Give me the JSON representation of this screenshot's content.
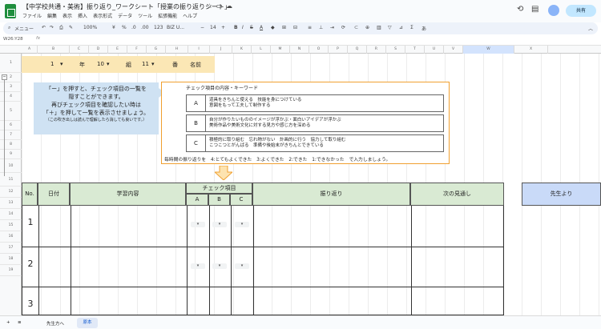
{
  "title": "【中学校共通・美術】振り返り_ワークシート「授業の振り返りシート」",
  "menu": [
    "ファイル",
    "編集",
    "表示",
    "挿入",
    "表示形式",
    "データ",
    "ツール",
    "拡張機能",
    "ヘルプ"
  ],
  "share_label": "共有",
  "toolbar": {
    "search": "メニュー",
    "zoom": "100%",
    "currency": "¥",
    "percent": "%",
    "dec1": ".0",
    "dec2": ".00",
    "num": "123",
    "font": "BIZ U...",
    "size": "14"
  },
  "namebox": "W26:Y28",
  "fx": "fx",
  "columns": [
    "A",
    "B",
    "C",
    "D",
    "E",
    "F",
    "G",
    "H",
    "I",
    "J",
    "K",
    "L",
    "M",
    "N",
    "O",
    "P",
    "Q",
    "R",
    "S",
    "T",
    "U",
    "V",
    "W",
    "X"
  ],
  "rows": [
    "1",
    "2",
    "3",
    "4",
    "5",
    "6",
    "7",
    "8",
    "9",
    "10",
    "11",
    "12",
    "13",
    "14",
    "15",
    "16",
    "17",
    "18",
    "19"
  ],
  "name_bar": {
    "grade": "1",
    "grade_label": "年",
    "class": "10",
    "class_label": "組",
    "number": "11",
    "number_label": "番",
    "name_label": "名前"
  },
  "help": {
    "line1": "「ー」を押すと、チェック項目の一覧を",
    "line2": "隠すことができます。",
    "line3": "再びチェック項目を確認したい時は",
    "line4": "「＋」を押して一覧を表示させましょう。",
    "line5": "（この吹き出しは読んで理解したら消しても良いです。）"
  },
  "check": {
    "heading": "チェック項目の内容・キーワード",
    "items": [
      {
        "key": "A",
        "line1": "道具をきちんと使える　技能を身につけている",
        "line2": "意図をもって工夫して制作する"
      },
      {
        "key": "B",
        "line1": "自分が作りたいもののイメージが浮かぶ・面白いアイデアが浮かぶ",
        "line2": "美術作品や美術文化に対する見方や感じ方を深める"
      },
      {
        "key": "C",
        "line1": "積極的に取り組む　忘れ物がない　計画的に行う　協力して取り組む",
        "line2": "こつこつとがんばる　準備や後始末がきちんとできている"
      }
    ],
    "note": "毎時間の振り返りを　4:とてもよくできた　3:よくできた　2:できた　1:できなかった　で入力しましょう。"
  },
  "table": {
    "no": "No.",
    "date": "日付",
    "content": "学習内容",
    "check": "チェック項目",
    "a": "A",
    "b": "B",
    "c": "C",
    "reflection": "振り返り",
    "next": "次の見通し",
    "teacher": "先生より"
  },
  "data_rows": [
    "1",
    "2",
    "3"
  ],
  "dropdown": "▾",
  "tabs": {
    "first": "先生方へ",
    "active": "原本"
  }
}
